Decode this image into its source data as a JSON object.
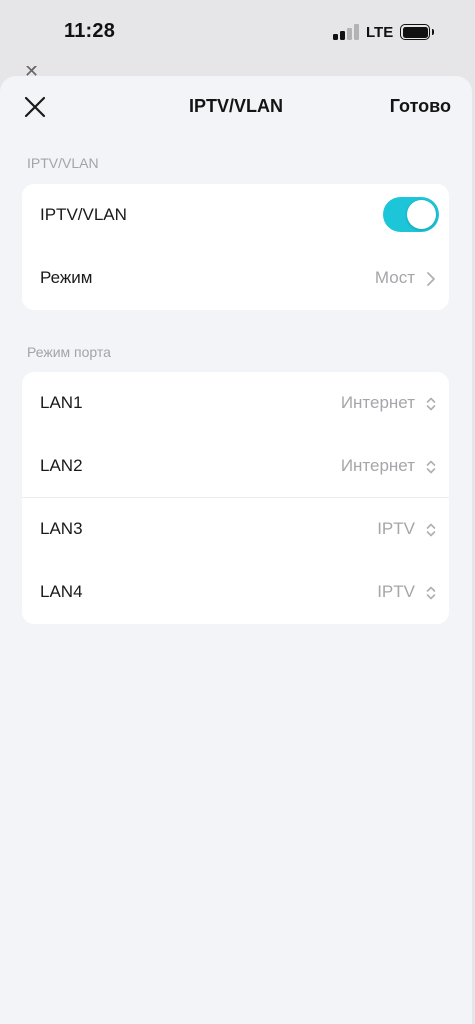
{
  "status_bar": {
    "time": "11:28",
    "network": "LTE",
    "signal_bars_filled": 2,
    "signal_bars_total": 4
  },
  "header": {
    "close_icon": "close-icon",
    "title": "IPTV/VLAN",
    "done_label": "Готово"
  },
  "section_iptv": {
    "header": "IPTV/VLAN",
    "toggle_label": "IPTV/VLAN",
    "toggle_on": true,
    "mode_label": "Режим",
    "mode_value": "Мост"
  },
  "section_ports": {
    "header": "Режим порта",
    "ports": [
      {
        "label": "LAN1",
        "value": "Интернет"
      },
      {
        "label": "LAN2",
        "value": "Интернет"
      },
      {
        "label": "LAN3",
        "value": "IPTV"
      },
      {
        "label": "LAN4",
        "value": "IPTV"
      }
    ]
  },
  "colors": {
    "accent": "#1cc6d8",
    "sheet_background": "#f3f4f8",
    "secondary_text": "#a6a6aa"
  }
}
